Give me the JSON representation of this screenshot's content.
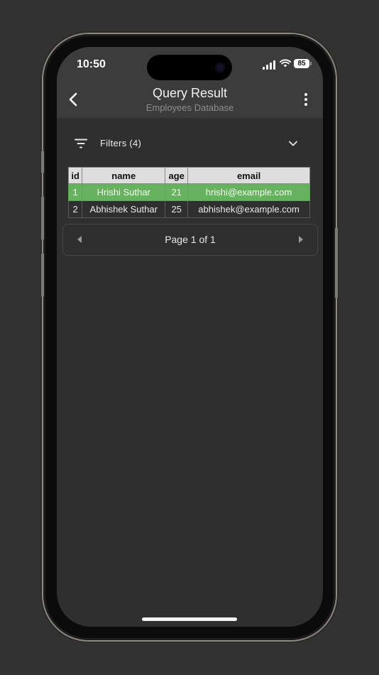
{
  "status": {
    "time": "10:50",
    "battery": "85"
  },
  "header": {
    "title": "Query Result",
    "subtitle": "Employees Database"
  },
  "filters": {
    "label": "Filters (4)"
  },
  "table": {
    "columns": [
      "id",
      "name",
      "age",
      "email"
    ],
    "rows": [
      {
        "id": "1",
        "name": "Hrishi Suthar",
        "age": "21",
        "email": "hrishi@example.com",
        "selected": true
      },
      {
        "id": "2",
        "name": "Abhishek Suthar",
        "age": "25",
        "email": "abhishek@example.com",
        "selected": false
      }
    ]
  },
  "pagination": {
    "label": "Page 1 of 1"
  },
  "colors": {
    "selected_row": "#66b25f",
    "header_bg": "#3c3c3c",
    "screen_bg": "#2f2f2f"
  },
  "icons": [
    "back-arrow-icon",
    "more-vertical-icon",
    "filter-icon",
    "chevron-down-icon",
    "arrow-left-icon",
    "arrow-right-icon",
    "cellular-signal-icon",
    "wifi-icon",
    "battery-icon"
  ]
}
